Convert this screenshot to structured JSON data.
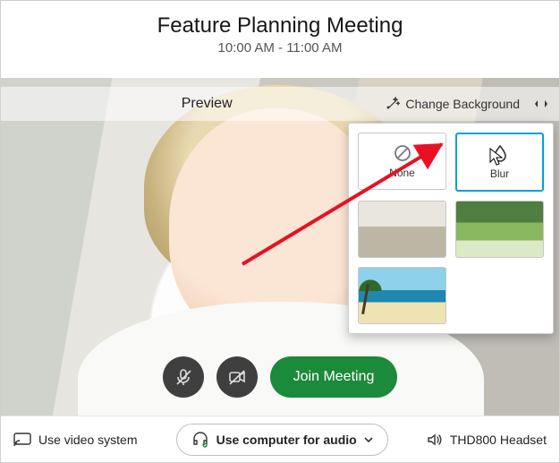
{
  "header": {
    "title": "Feature Planning Meeting",
    "timeRange": "10:00 AM - 11:00 AM"
  },
  "ribbon": {
    "previewLabel": "Preview",
    "changeBackground": "Change Background"
  },
  "backgroundOptions": [
    {
      "id": "none",
      "label": "None",
      "selected": false
    },
    {
      "id": "blur",
      "label": "Blur",
      "selected": true
    },
    {
      "id": "livingroom",
      "label": "",
      "selected": false
    },
    {
      "id": "forest",
      "label": "",
      "selected": false
    },
    {
      "id": "beach",
      "label": "",
      "selected": false
    }
  ],
  "controls": {
    "joinLabel": "Join Meeting"
  },
  "footer": {
    "videoSystem": "Use video system",
    "audioSource": "Use computer for audio",
    "headset": "THD800 Headset"
  },
  "colors": {
    "accent": "#049fd9",
    "primaryAction": "#1b8a3a",
    "annotation": "#e81123"
  }
}
